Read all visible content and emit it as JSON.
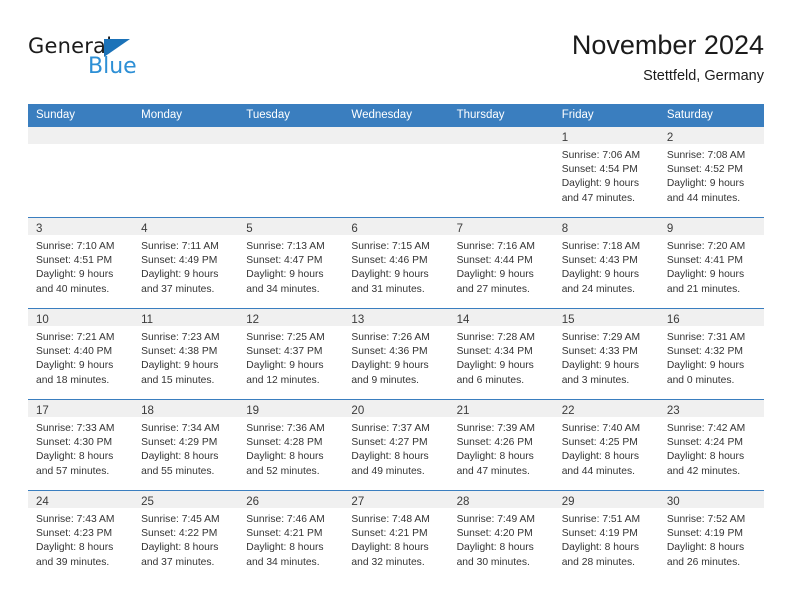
{
  "brand": {
    "name_part1": "General",
    "name_part2": "Blue",
    "accent_color": "#2d8fd5",
    "triangle_color": "#1b72b8"
  },
  "header": {
    "title": "November 2024",
    "subtitle": "Stettfeld, Germany"
  },
  "calendar": {
    "header_bg": "#3a7ebf",
    "daynum_band_bg": "#f0f0f0",
    "weekday_headers": [
      "Sunday",
      "Monday",
      "Tuesday",
      "Wednesday",
      "Thursday",
      "Friday",
      "Saturday"
    ],
    "weeks": [
      [
        {
          "day": "",
          "lines": []
        },
        {
          "day": "",
          "lines": []
        },
        {
          "day": "",
          "lines": []
        },
        {
          "day": "",
          "lines": []
        },
        {
          "day": "",
          "lines": []
        },
        {
          "day": "1",
          "lines": [
            "Sunrise: 7:06 AM",
            "Sunset: 4:54 PM",
            "Daylight: 9 hours",
            "and 47 minutes."
          ]
        },
        {
          "day": "2",
          "lines": [
            "Sunrise: 7:08 AM",
            "Sunset: 4:52 PM",
            "Daylight: 9 hours",
            "and 44 minutes."
          ]
        }
      ],
      [
        {
          "day": "3",
          "lines": [
            "Sunrise: 7:10 AM",
            "Sunset: 4:51 PM",
            "Daylight: 9 hours",
            "and 40 minutes."
          ]
        },
        {
          "day": "4",
          "lines": [
            "Sunrise: 7:11 AM",
            "Sunset: 4:49 PM",
            "Daylight: 9 hours",
            "and 37 minutes."
          ]
        },
        {
          "day": "5",
          "lines": [
            "Sunrise: 7:13 AM",
            "Sunset: 4:47 PM",
            "Daylight: 9 hours",
            "and 34 minutes."
          ]
        },
        {
          "day": "6",
          "lines": [
            "Sunrise: 7:15 AM",
            "Sunset: 4:46 PM",
            "Daylight: 9 hours",
            "and 31 minutes."
          ]
        },
        {
          "day": "7",
          "lines": [
            "Sunrise: 7:16 AM",
            "Sunset: 4:44 PM",
            "Daylight: 9 hours",
            "and 27 minutes."
          ]
        },
        {
          "day": "8",
          "lines": [
            "Sunrise: 7:18 AM",
            "Sunset: 4:43 PM",
            "Daylight: 9 hours",
            "and 24 minutes."
          ]
        },
        {
          "day": "9",
          "lines": [
            "Sunrise: 7:20 AM",
            "Sunset: 4:41 PM",
            "Daylight: 9 hours",
            "and 21 minutes."
          ]
        }
      ],
      [
        {
          "day": "10",
          "lines": [
            "Sunrise: 7:21 AM",
            "Sunset: 4:40 PM",
            "Daylight: 9 hours",
            "and 18 minutes."
          ]
        },
        {
          "day": "11",
          "lines": [
            "Sunrise: 7:23 AM",
            "Sunset: 4:38 PM",
            "Daylight: 9 hours",
            "and 15 minutes."
          ]
        },
        {
          "day": "12",
          "lines": [
            "Sunrise: 7:25 AM",
            "Sunset: 4:37 PM",
            "Daylight: 9 hours",
            "and 12 minutes."
          ]
        },
        {
          "day": "13",
          "lines": [
            "Sunrise: 7:26 AM",
            "Sunset: 4:36 PM",
            "Daylight: 9 hours",
            "and 9 minutes."
          ]
        },
        {
          "day": "14",
          "lines": [
            "Sunrise: 7:28 AM",
            "Sunset: 4:34 PM",
            "Daylight: 9 hours",
            "and 6 minutes."
          ]
        },
        {
          "day": "15",
          "lines": [
            "Sunrise: 7:29 AM",
            "Sunset: 4:33 PM",
            "Daylight: 9 hours",
            "and 3 minutes."
          ]
        },
        {
          "day": "16",
          "lines": [
            "Sunrise: 7:31 AM",
            "Sunset: 4:32 PM",
            "Daylight: 9 hours",
            "and 0 minutes."
          ]
        }
      ],
      [
        {
          "day": "17",
          "lines": [
            "Sunrise: 7:33 AM",
            "Sunset: 4:30 PM",
            "Daylight: 8 hours",
            "and 57 minutes."
          ]
        },
        {
          "day": "18",
          "lines": [
            "Sunrise: 7:34 AM",
            "Sunset: 4:29 PM",
            "Daylight: 8 hours",
            "and 55 minutes."
          ]
        },
        {
          "day": "19",
          "lines": [
            "Sunrise: 7:36 AM",
            "Sunset: 4:28 PM",
            "Daylight: 8 hours",
            "and 52 minutes."
          ]
        },
        {
          "day": "20",
          "lines": [
            "Sunrise: 7:37 AM",
            "Sunset: 4:27 PM",
            "Daylight: 8 hours",
            "and 49 minutes."
          ]
        },
        {
          "day": "21",
          "lines": [
            "Sunrise: 7:39 AM",
            "Sunset: 4:26 PM",
            "Daylight: 8 hours",
            "and 47 minutes."
          ]
        },
        {
          "day": "22",
          "lines": [
            "Sunrise: 7:40 AM",
            "Sunset: 4:25 PM",
            "Daylight: 8 hours",
            "and 44 minutes."
          ]
        },
        {
          "day": "23",
          "lines": [
            "Sunrise: 7:42 AM",
            "Sunset: 4:24 PM",
            "Daylight: 8 hours",
            "and 42 minutes."
          ]
        }
      ],
      [
        {
          "day": "24",
          "lines": [
            "Sunrise: 7:43 AM",
            "Sunset: 4:23 PM",
            "Daylight: 8 hours",
            "and 39 minutes."
          ]
        },
        {
          "day": "25",
          "lines": [
            "Sunrise: 7:45 AM",
            "Sunset: 4:22 PM",
            "Daylight: 8 hours",
            "and 37 minutes."
          ]
        },
        {
          "day": "26",
          "lines": [
            "Sunrise: 7:46 AM",
            "Sunset: 4:21 PM",
            "Daylight: 8 hours",
            "and 34 minutes."
          ]
        },
        {
          "day": "27",
          "lines": [
            "Sunrise: 7:48 AM",
            "Sunset: 4:21 PM",
            "Daylight: 8 hours",
            "and 32 minutes."
          ]
        },
        {
          "day": "28",
          "lines": [
            "Sunrise: 7:49 AM",
            "Sunset: 4:20 PM",
            "Daylight: 8 hours",
            "and 30 minutes."
          ]
        },
        {
          "day": "29",
          "lines": [
            "Sunrise: 7:51 AM",
            "Sunset: 4:19 PM",
            "Daylight: 8 hours",
            "and 28 minutes."
          ]
        },
        {
          "day": "30",
          "lines": [
            "Sunrise: 7:52 AM",
            "Sunset: 4:19 PM",
            "Daylight: 8 hours",
            "and 26 minutes."
          ]
        }
      ]
    ]
  }
}
